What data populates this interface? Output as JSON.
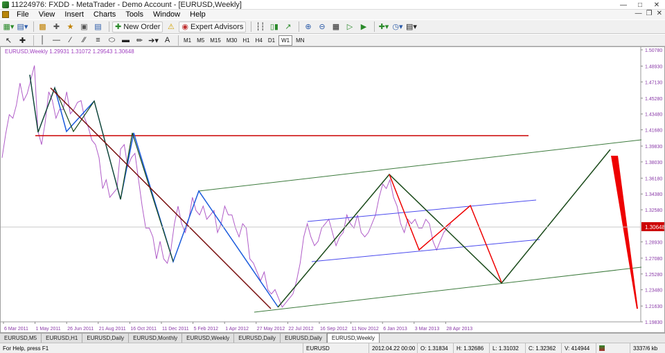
{
  "window": {
    "title": "11224976: FXDD - MetaTrader - Demo Account - [EURUSD,Weekly]"
  },
  "menu": [
    "File",
    "View",
    "Insert",
    "Charts",
    "Tools",
    "Window",
    "Help"
  ],
  "toolbar": {
    "new_order": "New Order",
    "expert_advisors": "Expert Advisors",
    "text_tool": "A",
    "timeframes": [
      "M1",
      "M5",
      "M15",
      "M30",
      "H1",
      "H4",
      "D1",
      "W1",
      "MN"
    ],
    "active_timeframe": "W1",
    "window_badge": "4"
  },
  "chart": {
    "header": "EURUSD,Weekly  1.29931 1.31072 1.29543 1.30648",
    "price_label": "1.30648",
    "colors": {
      "price": "#b05cc8",
      "current": "#cc0000",
      "background": "#ffffff"
    }
  },
  "chart_data": {
    "type": "line",
    "symbol": "EURUSD",
    "timeframe": "Weekly",
    "ohlc": {
      "open": 1.29931,
      "high": 1.31072,
      "low": 1.29543,
      "close": 1.30648
    },
    "y_ticks": [
      "1.50780",
      "1.48930",
      "1.47130",
      "1.45280",
      "1.43480",
      "1.41680",
      "1.39830",
      "1.38030",
      "1.36180",
      "1.34380",
      "1.32580",
      "1.30648",
      "1.28930",
      "1.27080",
      "1.25280",
      "1.23480",
      "1.21630",
      "1.19830"
    ],
    "x_ticks": [
      "6 Mar 2011",
      "1 May 2011",
      "26 Jun 2011",
      "21 Aug 2011",
      "16 Oct 2011",
      "11 Dec 2011",
      "5 Feb 2012",
      "1 Apr 2012",
      "27 May 2012",
      "22 Jul 2012",
      "16 Sep 2012",
      "11 Nov 2012",
      "6 Jan 2013",
      "3 Mar 2013",
      "28 Apr 2013"
    ],
    "ylim": [
      1.1983,
      1.5078
    ],
    "series": [
      {
        "style": "price",
        "y": [
          1.385,
          1.412,
          1.434,
          1.43,
          1.445,
          1.47,
          1.45,
          1.458,
          1.474,
          1.49,
          1.415,
          1.4,
          1.425,
          1.46,
          1.45,
          1.43,
          1.44,
          1.44,
          1.46,
          1.435,
          1.44,
          1.448,
          1.45,
          1.43,
          1.42,
          1.405,
          1.4,
          1.385,
          1.35,
          1.36,
          1.34,
          1.345,
          1.35,
          1.395,
          1.4,
          1.375,
          1.385,
          1.39,
          1.36,
          1.33,
          1.305,
          1.305,
          1.295,
          1.27,
          1.29,
          1.27,
          1.265,
          1.28,
          1.31,
          1.33,
          1.31,
          1.3,
          1.315,
          1.34,
          1.325,
          1.32,
          1.33,
          1.315,
          1.32,
          1.325,
          1.3,
          1.31,
          1.33,
          1.32,
          1.32,
          1.305,
          1.295,
          1.31,
          1.305,
          1.27,
          1.265,
          1.255,
          1.245,
          1.255,
          1.235,
          1.23,
          1.235,
          1.225,
          1.215,
          1.22,
          1.225,
          1.23,
          1.245,
          1.265,
          1.295,
          1.31,
          1.295,
          1.285,
          1.29,
          1.305,
          1.31,
          1.315,
          1.3,
          1.285,
          1.295,
          1.3,
          1.32,
          1.31,
          1.305,
          1.32,
          1.3,
          1.295,
          1.3,
          1.31,
          1.32,
          1.34,
          1.355,
          1.35,
          1.36,
          1.34,
          1.33,
          1.31,
          1.3,
          1.315,
          1.31,
          1.315,
          1.305,
          1.305,
          1.315,
          1.31,
          1.29,
          1.28,
          1.29,
          1.3,
          1.305,
          1.31
        ]
      }
    ]
  },
  "tabs": [
    "EURUSD,M5",
    "EURUSD,H1",
    "EURUSD,Daily",
    "EURUSD,Monthly",
    "EURUSD,Weekly",
    "EURUSD,Daily",
    "EURUSD,Daily",
    "EURUSD,Weekly"
  ],
  "active_tab_index": 7,
  "status": {
    "help": "For Help, press F1",
    "symbol": "EURUSD",
    "datetime": "2012.04.22 00:00",
    "open": "O: 1.31834",
    "high": "H: 1.32686",
    "low": "L: 1.31032",
    "close": "C: 1.32362",
    "volume": "V: 414944",
    "traffic": "3337/6 kb"
  }
}
